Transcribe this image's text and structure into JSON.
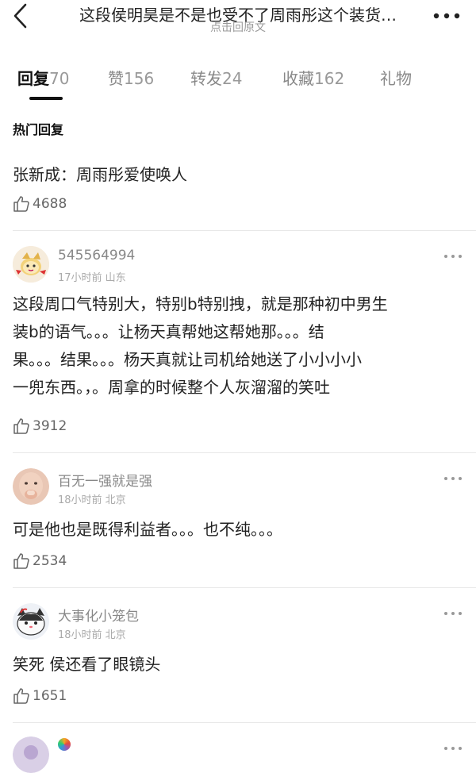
{
  "header": {
    "title": "这段侯明昊是不是也受不了周雨彤这个装货…",
    "subtitle": "点击回原文",
    "back_icon": "chevron-left-icon",
    "more_icon": "more-dots-icon"
  },
  "tabs": [
    {
      "label": "回复",
      "count": "70",
      "active": true
    },
    {
      "label": "赞",
      "count": "156",
      "active": false
    },
    {
      "label": "转发",
      "count": "24",
      "active": false
    },
    {
      "label": "收藏",
      "count": "162",
      "active": false
    },
    {
      "label": "礼物",
      "count": "",
      "active": false
    }
  ],
  "hot": {
    "section_title": "热门回复",
    "text": "张新成：周雨彤爱使唤人",
    "likes": "4688"
  },
  "comments": [
    {
      "username": "545564994",
      "meta": "17小时前 山东",
      "lines": [
        "这段周口气特别大，特别b特别拽，就是那种初中男生",
        "装b的语气。。。让杨天真帮她这帮她那。。。结",
        "果。。。结果。。。杨天真就让司机给她送了小小小小",
        "一兜东西。，。周拿的时候整个人灰溜溜的笑吐"
      ],
      "likes": "3912"
    },
    {
      "username": "百无一强就是强",
      "meta": "18小时前 北京",
      "lines": [
        "可是他也是既得利益者。。。也不纯。。。"
      ],
      "likes": "2534"
    },
    {
      "username": "大事化小笼包",
      "meta": "18小时前 北京",
      "lines": [
        "笑死 侯还看了眼镜头"
      ],
      "likes": "1651"
    }
  ],
  "colors": {
    "text": "#222222",
    "muted": "#888888",
    "divider": "#e8e8e8",
    "accent": "#111111"
  }
}
